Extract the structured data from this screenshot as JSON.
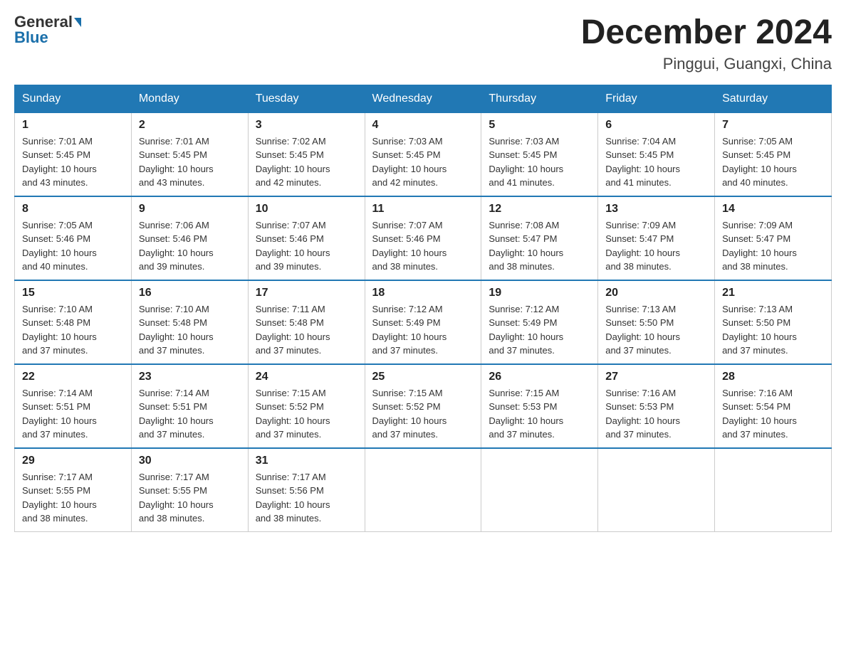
{
  "header": {
    "logo_general": "General",
    "logo_blue": "Blue",
    "month_title": "December 2024",
    "location": "Pinggui, Guangxi, China"
  },
  "weekdays": [
    "Sunday",
    "Monday",
    "Tuesday",
    "Wednesday",
    "Thursday",
    "Friday",
    "Saturday"
  ],
  "weeks": [
    [
      {
        "day": "1",
        "sunrise": "7:01 AM",
        "sunset": "5:45 PM",
        "daylight": "10 hours and 43 minutes."
      },
      {
        "day": "2",
        "sunrise": "7:01 AM",
        "sunset": "5:45 PM",
        "daylight": "10 hours and 43 minutes."
      },
      {
        "day": "3",
        "sunrise": "7:02 AM",
        "sunset": "5:45 PM",
        "daylight": "10 hours and 42 minutes."
      },
      {
        "day": "4",
        "sunrise": "7:03 AM",
        "sunset": "5:45 PM",
        "daylight": "10 hours and 42 minutes."
      },
      {
        "day": "5",
        "sunrise": "7:03 AM",
        "sunset": "5:45 PM",
        "daylight": "10 hours and 41 minutes."
      },
      {
        "day": "6",
        "sunrise": "7:04 AM",
        "sunset": "5:45 PM",
        "daylight": "10 hours and 41 minutes."
      },
      {
        "day": "7",
        "sunrise": "7:05 AM",
        "sunset": "5:45 PM",
        "daylight": "10 hours and 40 minutes."
      }
    ],
    [
      {
        "day": "8",
        "sunrise": "7:05 AM",
        "sunset": "5:46 PM",
        "daylight": "10 hours and 40 minutes."
      },
      {
        "day": "9",
        "sunrise": "7:06 AM",
        "sunset": "5:46 PM",
        "daylight": "10 hours and 39 minutes."
      },
      {
        "day": "10",
        "sunrise": "7:07 AM",
        "sunset": "5:46 PM",
        "daylight": "10 hours and 39 minutes."
      },
      {
        "day": "11",
        "sunrise": "7:07 AM",
        "sunset": "5:46 PM",
        "daylight": "10 hours and 38 minutes."
      },
      {
        "day": "12",
        "sunrise": "7:08 AM",
        "sunset": "5:47 PM",
        "daylight": "10 hours and 38 minutes."
      },
      {
        "day": "13",
        "sunrise": "7:09 AM",
        "sunset": "5:47 PM",
        "daylight": "10 hours and 38 minutes."
      },
      {
        "day": "14",
        "sunrise": "7:09 AM",
        "sunset": "5:47 PM",
        "daylight": "10 hours and 38 minutes."
      }
    ],
    [
      {
        "day": "15",
        "sunrise": "7:10 AM",
        "sunset": "5:48 PM",
        "daylight": "10 hours and 37 minutes."
      },
      {
        "day": "16",
        "sunrise": "7:10 AM",
        "sunset": "5:48 PM",
        "daylight": "10 hours and 37 minutes."
      },
      {
        "day": "17",
        "sunrise": "7:11 AM",
        "sunset": "5:48 PM",
        "daylight": "10 hours and 37 minutes."
      },
      {
        "day": "18",
        "sunrise": "7:12 AM",
        "sunset": "5:49 PM",
        "daylight": "10 hours and 37 minutes."
      },
      {
        "day": "19",
        "sunrise": "7:12 AM",
        "sunset": "5:49 PM",
        "daylight": "10 hours and 37 minutes."
      },
      {
        "day": "20",
        "sunrise": "7:13 AM",
        "sunset": "5:50 PM",
        "daylight": "10 hours and 37 minutes."
      },
      {
        "day": "21",
        "sunrise": "7:13 AM",
        "sunset": "5:50 PM",
        "daylight": "10 hours and 37 minutes."
      }
    ],
    [
      {
        "day": "22",
        "sunrise": "7:14 AM",
        "sunset": "5:51 PM",
        "daylight": "10 hours and 37 minutes."
      },
      {
        "day": "23",
        "sunrise": "7:14 AM",
        "sunset": "5:51 PM",
        "daylight": "10 hours and 37 minutes."
      },
      {
        "day": "24",
        "sunrise": "7:15 AM",
        "sunset": "5:52 PM",
        "daylight": "10 hours and 37 minutes."
      },
      {
        "day": "25",
        "sunrise": "7:15 AM",
        "sunset": "5:52 PM",
        "daylight": "10 hours and 37 minutes."
      },
      {
        "day": "26",
        "sunrise": "7:15 AM",
        "sunset": "5:53 PM",
        "daylight": "10 hours and 37 minutes."
      },
      {
        "day": "27",
        "sunrise": "7:16 AM",
        "sunset": "5:53 PM",
        "daylight": "10 hours and 37 minutes."
      },
      {
        "day": "28",
        "sunrise": "7:16 AM",
        "sunset": "5:54 PM",
        "daylight": "10 hours and 37 minutes."
      }
    ],
    [
      {
        "day": "29",
        "sunrise": "7:17 AM",
        "sunset": "5:55 PM",
        "daylight": "10 hours and 38 minutes."
      },
      {
        "day": "30",
        "sunrise": "7:17 AM",
        "sunset": "5:55 PM",
        "daylight": "10 hours and 38 minutes."
      },
      {
        "day": "31",
        "sunrise": "7:17 AM",
        "sunset": "5:56 PM",
        "daylight": "10 hours and 38 minutes."
      },
      null,
      null,
      null,
      null
    ]
  ],
  "labels": {
    "sunrise_prefix": "Sunrise: ",
    "sunset_prefix": "Sunset: ",
    "daylight_prefix": "Daylight: "
  }
}
